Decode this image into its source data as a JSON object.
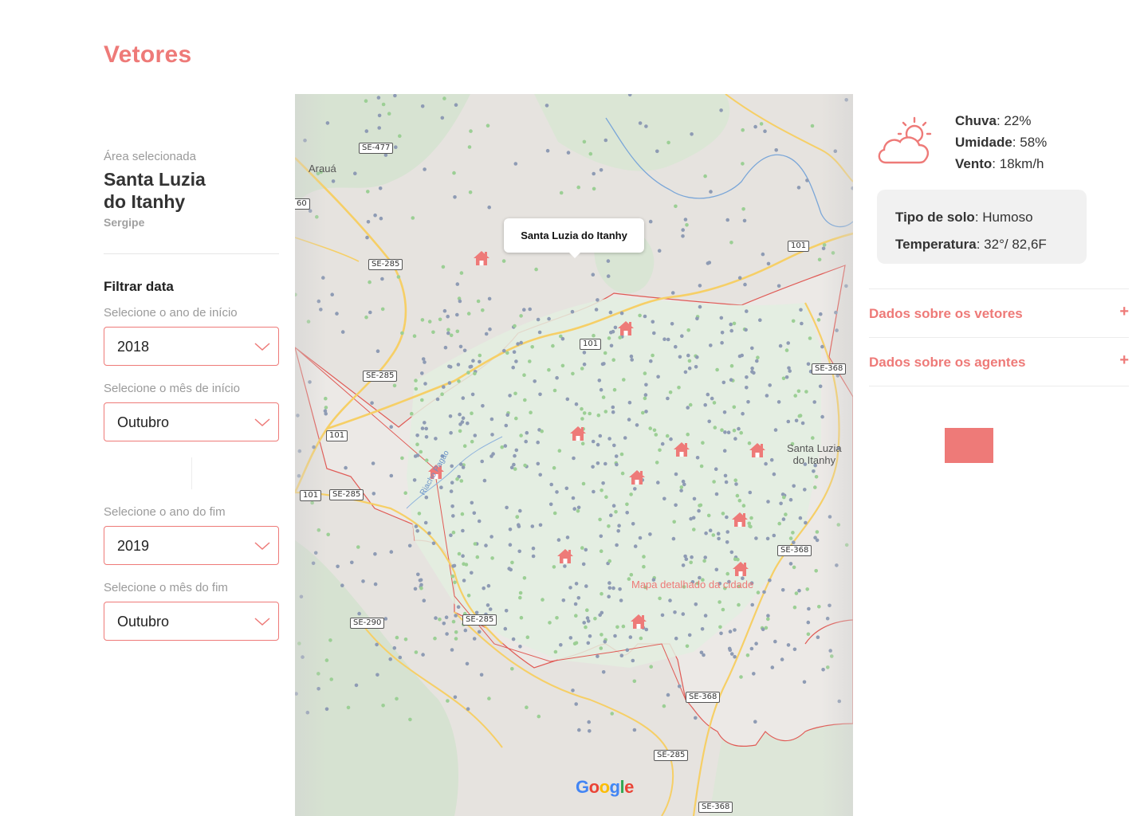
{
  "page": {
    "title": "Vetores"
  },
  "area": {
    "label": "Área selecionada",
    "name": "Santa Luzia\ndo Itanhy",
    "state": "Sergipe"
  },
  "filter": {
    "title": "Filtrar data",
    "start_year": {
      "label": "Selecione o ano de início",
      "value": "2018"
    },
    "start_month": {
      "label": "Selecione o mês de início",
      "value": "Outubro"
    },
    "end_year": {
      "label": "Selecione o ano do fim",
      "value": "2019"
    },
    "end_month": {
      "label": "Selecione o mês do fim",
      "value": "Outubro"
    }
  },
  "map": {
    "tooltip": "Santa Luzia do Itanhy",
    "caption": "Mapa detalhado da cidade",
    "towns": [
      "Arauá",
      "Santa Luzia\ndo Itanhy"
    ],
    "river": "Riacho Pagão",
    "road_tags": [
      "SE-477",
      "60",
      "SE-285",
      "101",
      "SE-285",
      "101",
      "101",
      "SE-285",
      "SE-368",
      "101",
      "SE-368",
      "SE-290",
      "SE-285",
      "SE-368",
      "SE-285",
      "SE-368"
    ],
    "logo": "Google",
    "colors": {
      "outline": "#e05a55",
      "blue_dot": "#8e9bb4",
      "green_dot": "#9ccf95",
      "marker": "#ee7a78"
    }
  },
  "weather": {
    "icon": "cloud-sun-icon",
    "rain_label": "Chuva",
    "rain_value": ": 22%",
    "humidity_label": "Umidade",
    "humidity_value": ": 58%",
    "wind_label": "Vento",
    "wind_value": ": 18km/h"
  },
  "soil": {
    "type_label": "Tipo de solo",
    "type_value": ": Humoso",
    "temp_label": "Temperatura",
    "temp_value": ": 32°/ 82,6F"
  },
  "accordion": [
    {
      "label": "Dados sobre os vetores",
      "icon": "+"
    },
    {
      "label": "Dados sobre os agentes",
      "icon": "+"
    }
  ],
  "accent": "#ee7a78"
}
